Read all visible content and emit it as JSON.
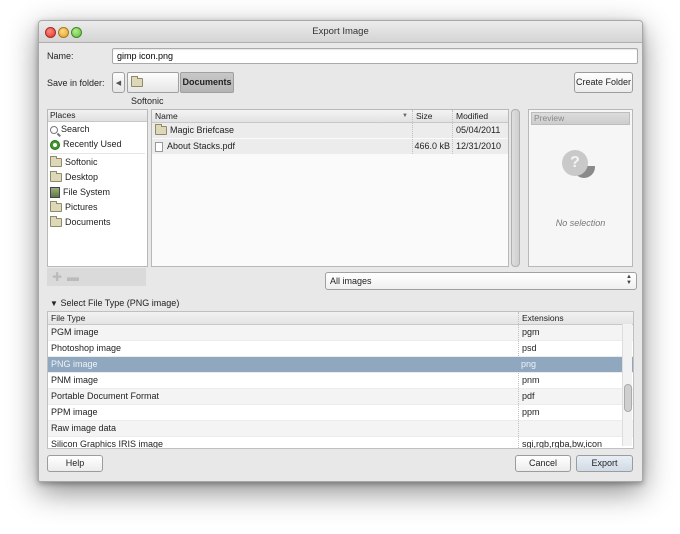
{
  "window": {
    "title": "Export Image"
  },
  "name_field": {
    "label": "Name:",
    "value": "gimp icon.png"
  },
  "save_in": {
    "label": "Save in folder:",
    "path": [
      {
        "label": "Softonic",
        "icon": "folder-icon"
      },
      {
        "label": "Documents",
        "icon": null
      }
    ],
    "create_folder_label": "Create Folder"
  },
  "places": {
    "header": "Places",
    "items": [
      {
        "label": "Search",
        "icon": "search-icon"
      },
      {
        "label": "Recently Used",
        "icon": "recently-used-icon"
      },
      {
        "label": "Softonic",
        "icon": "folder-icon"
      },
      {
        "label": "Desktop",
        "icon": "folder-icon"
      },
      {
        "label": "File System",
        "icon": "file-system-icon"
      },
      {
        "label": "Pictures",
        "icon": "folder-icon"
      },
      {
        "label": "Documents",
        "icon": "folder-icon"
      }
    ],
    "add_icon": "plus-icon",
    "remove_icon": "minus-icon"
  },
  "files": {
    "columns": {
      "name": "Name",
      "size": "Size",
      "modified": "Modified"
    },
    "rows": [
      {
        "name": "Magic Briefcase",
        "size": "",
        "modified": "05/04/2011",
        "icon": "folder-icon"
      },
      {
        "name": "About Stacks.pdf",
        "size": "466.0 kB",
        "modified": "12/31/2010",
        "icon": "document-icon"
      }
    ]
  },
  "preview": {
    "header": "Preview",
    "empty_text": "No selection"
  },
  "filter": {
    "selected": "All images"
  },
  "file_type": {
    "expander_label": "Select File Type (PNG image)",
    "columns": {
      "type": "File Type",
      "extensions": "Extensions"
    },
    "rows": [
      {
        "type": "PGM image",
        "ext": "pgm"
      },
      {
        "type": "Photoshop image",
        "ext": "psd"
      },
      {
        "type": "PNG image",
        "ext": "png",
        "selected": true
      },
      {
        "type": "PNM image",
        "ext": "pnm"
      },
      {
        "type": "Portable Document Format",
        "ext": "pdf"
      },
      {
        "type": "PPM image",
        "ext": "ppm"
      },
      {
        "type": "Raw image data",
        "ext": ""
      },
      {
        "type": "Silicon Graphics IRIS image",
        "ext": "sgi,rgb,rgba,bw,icon"
      }
    ]
  },
  "buttons": {
    "help": "Help",
    "cancel": "Cancel",
    "export": "Export"
  }
}
